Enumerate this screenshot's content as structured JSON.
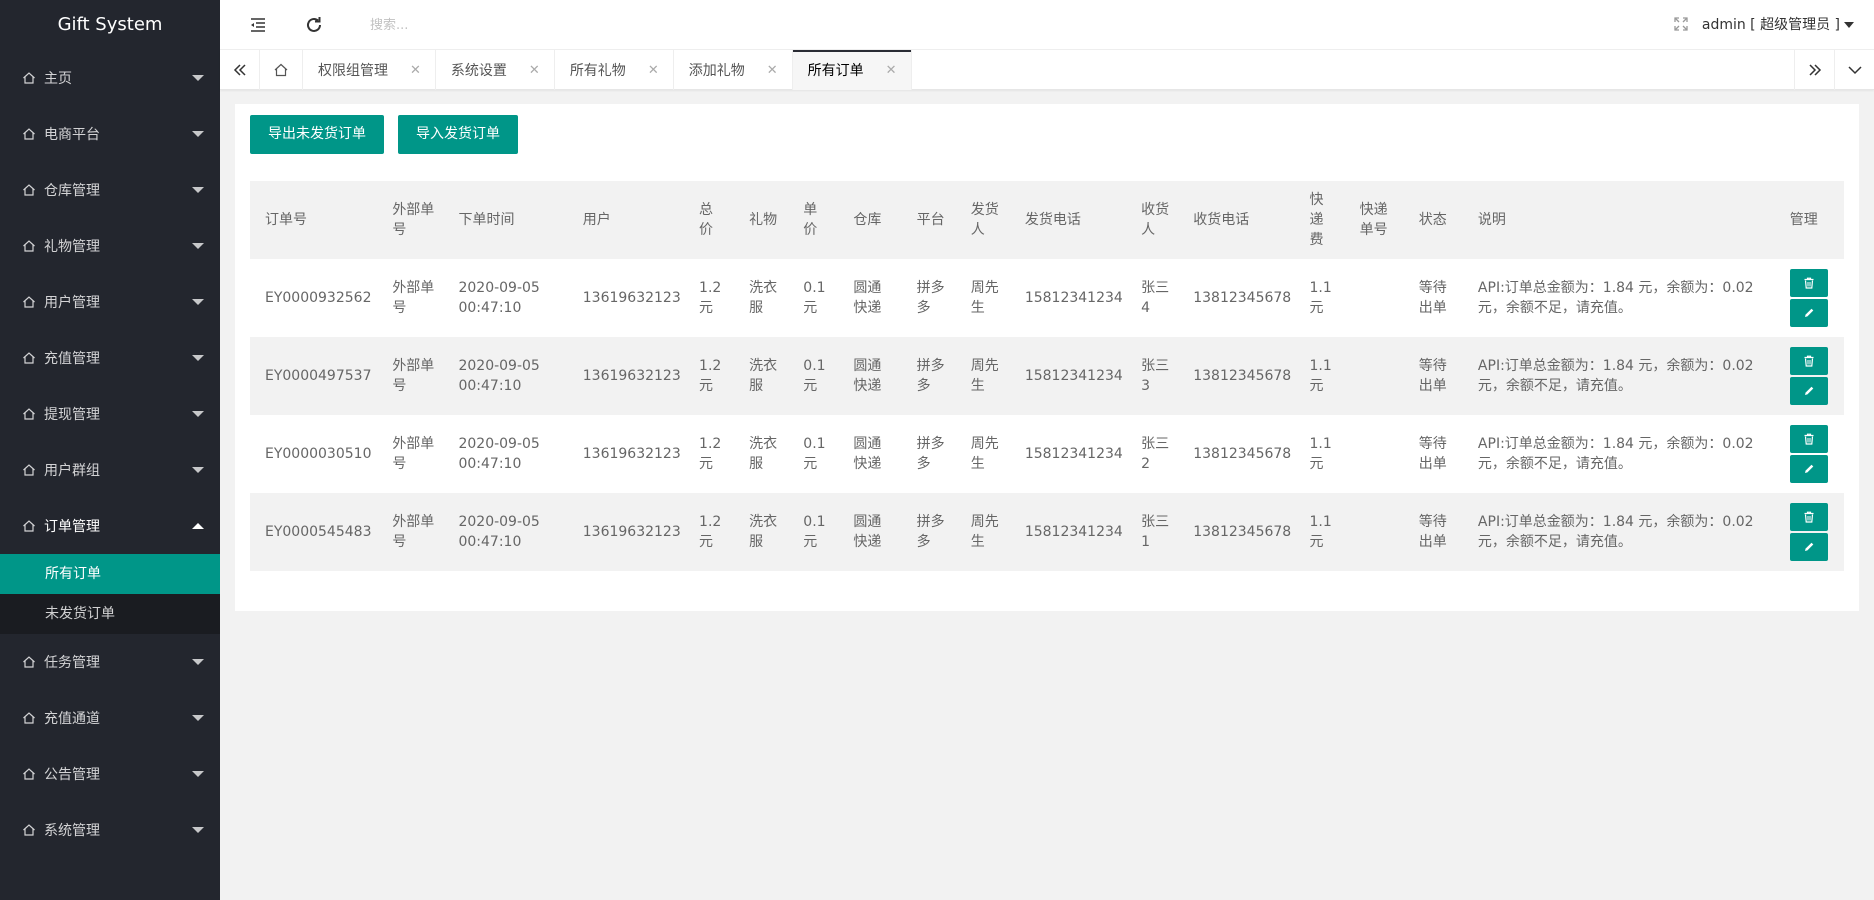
{
  "app": {
    "title": "Gift System"
  },
  "sidebar": {
    "items": [
      {
        "label": "主页"
      },
      {
        "label": "电商平台"
      },
      {
        "label": "仓库管理"
      },
      {
        "label": "礼物管理"
      },
      {
        "label": "用户管理"
      },
      {
        "label": "充值管理"
      },
      {
        "label": "提现管理"
      },
      {
        "label": "用户群组"
      },
      {
        "label": "订单管理",
        "expanded": true,
        "children": [
          {
            "label": "所有订单",
            "active": true
          },
          {
            "label": "未发货订单"
          }
        ]
      },
      {
        "label": "任务管理"
      },
      {
        "label": "充值通道"
      },
      {
        "label": "公告管理"
      },
      {
        "label": "系统管理"
      }
    ]
  },
  "header": {
    "search_placeholder": "搜索...",
    "user_label": "admin [ 超级管理员 ]"
  },
  "tabs": [
    {
      "label": "权限组管理"
    },
    {
      "label": "系统设置"
    },
    {
      "label": "所有礼物"
    },
    {
      "label": "添加礼物"
    },
    {
      "label": "所有订单",
      "active": true
    }
  ],
  "toolbar": {
    "export_label": "导出未发货订单",
    "import_label": "导入发货订单"
  },
  "table": {
    "columns": [
      "订单号",
      "外部单号",
      "下单时间",
      "用户",
      "总价",
      "礼物",
      "单价",
      "仓库",
      "平台",
      "发货人",
      "发货电话",
      "收货人",
      "收货电话",
      "快递费",
      "快递单号",
      "状态",
      "说明",
      "管理"
    ],
    "rows": [
      [
        "EY0000932562",
        "外部单号",
        "2020-09-05 00:47:10",
        "13619632123",
        "1.2元",
        "洗衣服",
        "0.1元",
        "圆通快递",
        "拼多多",
        "周先生",
        "15812341234",
        "张三4",
        "13812345678",
        "1.1元",
        "",
        "等待出单",
        "API:订单总金额为：1.84 元，余额为：0.02 元，余额不足，请充值。"
      ],
      [
        "EY0000497537",
        "外部单号",
        "2020-09-05 00:47:10",
        "13619632123",
        "1.2元",
        "洗衣服",
        "0.1元",
        "圆通快递",
        "拼多多",
        "周先生",
        "15812341234",
        "张三3",
        "13812345678",
        "1.1元",
        "",
        "等待出单",
        "API:订单总金额为：1.84 元，余额为：0.02 元，余额不足，请充值。"
      ],
      [
        "EY0000030510",
        "外部单号",
        "2020-09-05 00:47:10",
        "13619632123",
        "1.2元",
        "洗衣服",
        "0.1元",
        "圆通快递",
        "拼多多",
        "周先生",
        "15812341234",
        "张三2",
        "13812345678",
        "1.1元",
        "",
        "等待出单",
        "API:订单总金额为：1.84 元，余额为：0.02 元，余额不足，请充值。"
      ],
      [
        "EY0000545483",
        "外部单号",
        "2020-09-05 00:47:10",
        "13619632123",
        "1.2元",
        "洗衣服",
        "0.1元",
        "圆通快递",
        "拼多多",
        "周先生",
        "15812341234",
        "张三1",
        "13812345678",
        "1.1元",
        "",
        "等待出单",
        "API:订单总金额为：1.84 元，余额为：0.02 元，余额不足，请充值。"
      ]
    ]
  },
  "colors": {
    "sidebar_bg": "#23262e",
    "accent": "#009688"
  }
}
